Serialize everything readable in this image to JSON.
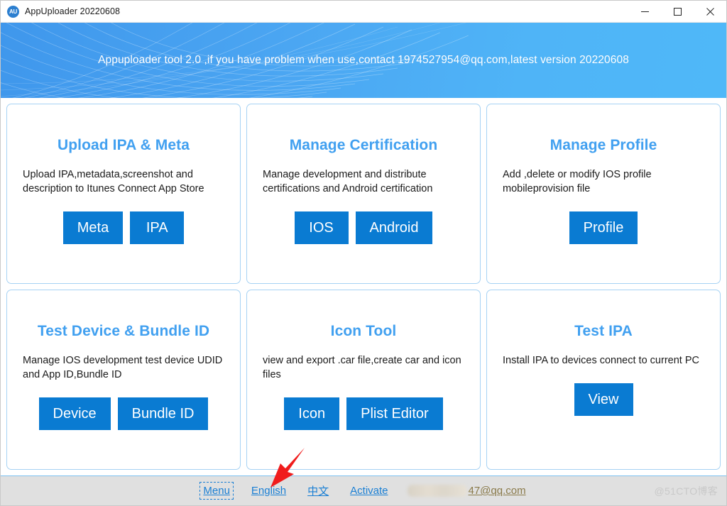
{
  "window": {
    "title": "AppUploader 20220608",
    "app_icon_label": "AU",
    "controls": {
      "minimize": "—",
      "maximize": "□",
      "close": "✕"
    }
  },
  "banner": {
    "text": "Appuploader tool 2.0 ,if you have problem when use,contact 1974527954@qq.com,latest version 20220608",
    "color_left": "#3f97ec",
    "color_right": "#4fb8f8"
  },
  "cards": [
    {
      "title": "Upload IPA & Meta",
      "description": "Upload IPA,metadata,screenshot and description to Itunes Connect App Store",
      "buttons": [
        "Meta",
        "IPA"
      ]
    },
    {
      "title": "Manage Certification",
      "description": "Manage development and distribute certifications and Android certification",
      "buttons": [
        "IOS",
        "Android"
      ]
    },
    {
      "title": "Manage Profile",
      "description": "Add ,delete or modify IOS profile mobileprovision file",
      "buttons": [
        "Profile"
      ]
    },
    {
      "title": "Test Device & Bundle ID",
      "description": "Manage IOS development test device UDID and App ID,Bundle ID",
      "buttons": [
        "Device",
        "Bundle ID"
      ]
    },
    {
      "title": "Icon Tool",
      "description": "view and export .car file,create car and icon files",
      "buttons": [
        "Icon",
        "Plist Editor"
      ]
    },
    {
      "title": "Test IPA",
      "description": "Install IPA to devices connect to current PC",
      "buttons": [
        "View"
      ]
    }
  ],
  "footer": {
    "links": [
      {
        "label": "Menu",
        "focused": true
      },
      {
        "label": "English",
        "focused": false
      },
      {
        "label": "中文",
        "focused": false
      },
      {
        "label": "Activate",
        "focused": false
      }
    ],
    "account_email": "47@qq.com",
    "watermark": "@51CTO博客"
  },
  "annotation": {
    "type": "red-arrow",
    "points_to": "中文",
    "color": "#f01c1c"
  },
  "theme": {
    "accent": "#0a7bd2",
    "card_title": "#41a0f0",
    "card_border": "#a6d2f4",
    "link": "#1a7fd4",
    "footer_bg": "#e0e0e0"
  }
}
